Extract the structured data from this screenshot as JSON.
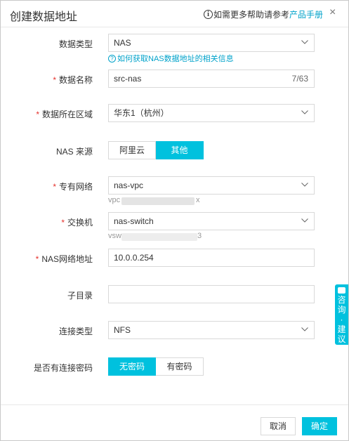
{
  "dialog": {
    "title": "创建数据地址",
    "help_prefix": "如需更多帮助请参考",
    "help_link": "产品手册",
    "close_label": "×"
  },
  "form": {
    "data_type": {
      "label": "数据类型",
      "value": "NAS",
      "hint": "如何获取NAS数据地址的相关信息"
    },
    "data_name": {
      "label": "数据名称",
      "value": "src-nas",
      "count": "7/63"
    },
    "region": {
      "label": "数据所在区域",
      "value": "华东1（杭州）"
    },
    "nas_source": {
      "label": "NAS 来源",
      "options": [
        "阿里云",
        "其他"
      ],
      "selected": "其他"
    },
    "vpc": {
      "label": "专有网络",
      "value": "nas-vpc",
      "sub_prefix": "vpc",
      "sub_suffix": "x"
    },
    "vswitch": {
      "label": "交换机",
      "value": "nas-switch",
      "sub_prefix": "vsw",
      "sub_suffix": "3"
    },
    "nas_address": {
      "label": "NAS网络地址",
      "value": "10.0.0.254"
    },
    "subdir": {
      "label": "子目录",
      "value": ""
    },
    "connection_type": {
      "label": "连接类型",
      "value": "NFS"
    },
    "password": {
      "label": "是否有连接密码",
      "options": [
        "无密码",
        "有密码"
      ],
      "selected": "无密码"
    }
  },
  "footer": {
    "cancel_label": "取消",
    "ok_label": "确定"
  },
  "consult_widget": {
    "label_1": "咨",
    "label_2": "询",
    "dot": "·",
    "label_3": "建",
    "label_4": "议"
  },
  "colors": {
    "accent": "#00c1de",
    "link": "#00a2ca",
    "required": "#e5322d"
  }
}
